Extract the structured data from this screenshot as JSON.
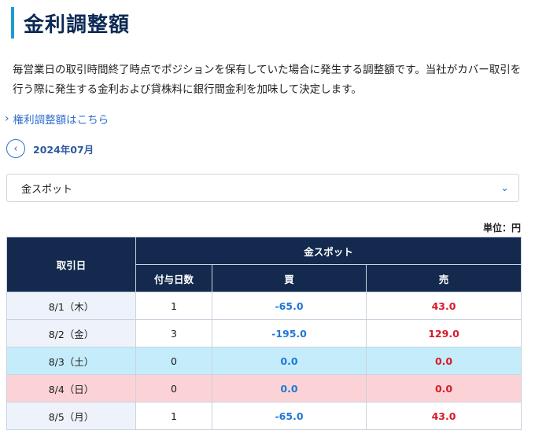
{
  "page": {
    "title": "金利調整額",
    "description": "毎営業日の取引時間終了時点でポジションを保有していた場合に発生する調整額です。当社がカバー取引を行う際に発生する金利および貸株料に銀行間金利を加味して決定します。",
    "link_label": "権利調整額はこちら",
    "month_label": "2024年07月",
    "select_value": "金スポット",
    "unit_label": "単位：円"
  },
  "table": {
    "header_date": "取引日",
    "header_group": "金スポット",
    "header_days": "付与日数",
    "header_buy": "買",
    "header_sell": "売",
    "rows": [
      {
        "date": "8/1（木）",
        "days": "1",
        "buy": "-65.0",
        "sell": "43.0",
        "type": "weekday"
      },
      {
        "date": "8/2（金）",
        "days": "3",
        "buy": "-195.0",
        "sell": "129.0",
        "type": "weekday"
      },
      {
        "date": "8/3（土）",
        "days": "0",
        "buy": "0.0",
        "sell": "0.0",
        "type": "sat"
      },
      {
        "date": "8/4（日）",
        "days": "0",
        "buy": "0.0",
        "sell": "0.0",
        "type": "sun"
      },
      {
        "date": "8/5（月）",
        "days": "1",
        "buy": "-65.0",
        "sell": "43.0",
        "type": "weekday"
      }
    ]
  },
  "colors": {
    "header_bg": "#13294e",
    "accent": "#1f9bd1",
    "buy": "#1f78d6",
    "sell": "#d81b2a",
    "saturday": "#c5ecfa",
    "sunday": "#fbd3d6"
  }
}
